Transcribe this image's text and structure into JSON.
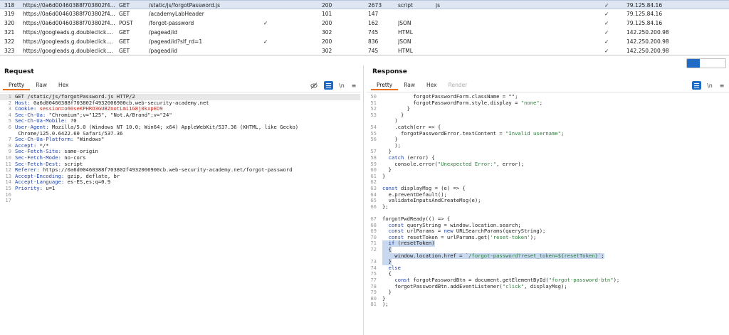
{
  "history": {
    "rows": [
      {
        "num": "318",
        "host": "https://0a6d00460388f703802f4...",
        "method": "GET",
        "url": "/static/js/forgotPassword.js",
        "params": "",
        "status": "200",
        "length": "2673",
        "mime": "script",
        "ext": "js",
        "checked": "✓",
        "ip": "79.125.84.16",
        "selected": true
      },
      {
        "num": "319",
        "host": "https://0a6d00460388f703802f4...",
        "method": "GET",
        "url": "/academyLabHeader",
        "params": "",
        "status": "101",
        "length": "147",
        "mime": "",
        "ext": "",
        "checked": "✓",
        "ip": "79.125.84.16"
      },
      {
        "num": "320",
        "host": "https://0a6d00460388f703802f4...",
        "method": "POST",
        "url": "/forgot-password",
        "params": "✓",
        "status": "200",
        "length": "162",
        "mime": "JSON",
        "ext": "",
        "checked": "✓",
        "ip": "79.125.84.16"
      },
      {
        "num": "321",
        "host": "https://googleads.g.doubleclick....",
        "method": "GET",
        "url": "/pagead/id",
        "params": "",
        "status": "302",
        "length": "745",
        "mime": "HTML",
        "ext": "",
        "checked": "✓",
        "ip": "142.250.200.98"
      },
      {
        "num": "322",
        "host": "https://googleads.g.doubleclick....",
        "method": "GET",
        "url": "/pagead/id?slf_rd=1",
        "params": "✓",
        "status": "200",
        "length": "836",
        "mime": "JSON",
        "ext": "",
        "checked": "✓",
        "ip": "142.250.200.98"
      },
      {
        "num": "323",
        "host": "https://googleads.g.doubleclick....",
        "method": "GET",
        "url": "/pagead/id",
        "params": "",
        "status": "302",
        "length": "745",
        "mime": "HTML",
        "ext": "",
        "checked": "✓",
        "ip": "142.250.200.98"
      }
    ]
  },
  "request": {
    "title": "Request",
    "tabs": [
      "Pretty",
      "Raw",
      "Hex"
    ],
    "active_tab": "Pretty",
    "tool_ln": "\\n",
    "lines": [
      {
        "n": "1",
        "parts": [
          [
            "v",
            "GET /static/js/forgotPassword.js HTTP/2"
          ]
        ],
        "current": true
      },
      {
        "n": "2",
        "parts": [
          [
            "k",
            "Host: "
          ],
          [
            "v",
            "0a6d00460388f703802f4932006900cb.web-security-academy.net"
          ]
        ]
      },
      {
        "n": "3",
        "parts": [
          [
            "k",
            "Cookie: "
          ],
          [
            "red",
            "session=o60seKPHRO3GUBZnotLmi1G8j0kxpED9"
          ]
        ]
      },
      {
        "n": "4",
        "parts": [
          [
            "k",
            "Sec-Ch-Ua: "
          ],
          [
            "v",
            "\"Chromium\";v=\"125\", \"Not.A/Brand\";v=\"24\""
          ]
        ]
      },
      {
        "n": "5",
        "parts": [
          [
            "k",
            "Sec-Ch-Ua-Mobile: "
          ],
          [
            "v",
            "?0"
          ]
        ]
      },
      {
        "n": "6",
        "parts": [
          [
            "k",
            "User-Agent: "
          ],
          [
            "v",
            "Mozilla/5.0 (Windows NT 10.0; Win64; x64) AppleWebKit/537.36 (KHTML, like Gecko)"
          ]
        ]
      },
      {
        "n": "",
        "parts": [
          [
            "v",
            " Chrome/125.0.6422.60 Safari/537.36"
          ]
        ]
      },
      {
        "n": "7",
        "parts": [
          [
            "k",
            "Sec-Ch-Ua-Platform: "
          ],
          [
            "v",
            "\"Windows\""
          ]
        ]
      },
      {
        "n": "8",
        "parts": [
          [
            "k",
            "Accept: "
          ],
          [
            "v",
            "*/*"
          ]
        ]
      },
      {
        "n": "9",
        "parts": [
          [
            "k",
            "Sec-Fetch-Site: "
          ],
          [
            "v",
            "same-origin"
          ]
        ]
      },
      {
        "n": "10",
        "parts": [
          [
            "k",
            "Sec-Fetch-Mode: "
          ],
          [
            "v",
            "no-cors"
          ]
        ]
      },
      {
        "n": "11",
        "parts": [
          [
            "k",
            "Sec-Fetch-Dest: "
          ],
          [
            "v",
            "script"
          ]
        ]
      },
      {
        "n": "12",
        "parts": [
          [
            "k",
            "Referer: "
          ],
          [
            "v",
            "https://0a6d00460388f703802f4932006900cb.web-security-academy.net/forgot-password"
          ]
        ]
      },
      {
        "n": "13",
        "parts": [
          [
            "k",
            "Accept-Encoding: "
          ],
          [
            "v",
            "gzip, deflate, br"
          ]
        ]
      },
      {
        "n": "14",
        "parts": [
          [
            "k",
            "Accept-Language: "
          ],
          [
            "v",
            "es-ES,es;q=0.9"
          ]
        ]
      },
      {
        "n": "15",
        "parts": [
          [
            "k",
            "Priority: "
          ],
          [
            "v",
            "u=1"
          ]
        ]
      },
      {
        "n": "16",
        "parts": []
      },
      {
        "n": "17",
        "parts": []
      }
    ]
  },
  "response": {
    "title": "Response",
    "tabs": [
      "Pretty",
      "Raw",
      "Hex",
      "Render"
    ],
    "active_tab": "Pretty",
    "tool_ln": "\\n",
    "lines": [
      {
        "n": "50",
        "parts": [
          [
            "v",
            "          forgotPasswordForm.className = \"\";"
          ]
        ]
      },
      {
        "n": "51",
        "parts": [
          [
            "v",
            "          forgotPasswordForm.style.display = "
          ],
          [
            "str",
            "\"none\""
          ],
          [
            "v",
            ";"
          ]
        ]
      },
      {
        "n": "52",
        "parts": [
          [
            "v",
            "        }"
          ]
        ]
      },
      {
        "n": "53",
        "parts": [
          [
            "v",
            "      }"
          ]
        ]
      },
      {
        "n": "",
        "parts": [
          [
            "v",
            "    )"
          ]
        ]
      },
      {
        "n": "54",
        "parts": [
          [
            "v",
            "    .catch(err => {"
          ]
        ]
      },
      {
        "n": "55",
        "parts": [
          [
            "v",
            "      forgotPasswordError.textContent = "
          ],
          [
            "str",
            "\"Invalid username\""
          ],
          [
            "v",
            ";"
          ]
        ]
      },
      {
        "n": "56",
        "parts": [
          [
            "v",
            "    }"
          ]
        ]
      },
      {
        "n": "",
        "parts": [
          [
            "v",
            "    );"
          ]
        ]
      },
      {
        "n": "57",
        "parts": [
          [
            "v",
            "  }"
          ]
        ]
      },
      {
        "n": "58",
        "parts": [
          [
            "v",
            "  "
          ],
          [
            "kw",
            "catch"
          ],
          [
            "v",
            " (error) {"
          ]
        ]
      },
      {
        "n": "59",
        "parts": [
          [
            "v",
            "    console.error("
          ],
          [
            "str",
            "\"Unexpected Error:\""
          ],
          [
            "v",
            ", error);"
          ]
        ]
      },
      {
        "n": "60",
        "parts": [
          [
            "v",
            "  }"
          ]
        ]
      },
      {
        "n": "61",
        "parts": [
          [
            "v",
            "}"
          ]
        ]
      },
      {
        "n": "62",
        "parts": []
      },
      {
        "n": "63",
        "parts": [
          [
            "kw",
            "const"
          ],
          [
            "v",
            " displayMsg = (e) => {"
          ]
        ]
      },
      {
        "n": "64",
        "parts": [
          [
            "v",
            "  e.preventDefault();"
          ]
        ]
      },
      {
        "n": "65",
        "parts": [
          [
            "v",
            "  validateInputsAndCreateMsg(e);"
          ]
        ]
      },
      {
        "n": "66",
        "parts": [
          [
            "v",
            "};"
          ]
        ]
      },
      {
        "n": "",
        "parts": []
      },
      {
        "n": "67",
        "parts": [
          [
            "v",
            "forgotPwdReady(() => {"
          ]
        ]
      },
      {
        "n": "68",
        "parts": [
          [
            "v",
            "  "
          ],
          [
            "kw",
            "const"
          ],
          [
            "v",
            " queryString = window.location.search;"
          ]
        ]
      },
      {
        "n": "69",
        "parts": [
          [
            "v",
            "  "
          ],
          [
            "kw",
            "const"
          ],
          [
            "v",
            " urlParams = "
          ],
          [
            "kw",
            "new"
          ],
          [
            "v",
            " URLSearchParams(queryString);"
          ]
        ]
      },
      {
        "n": "70",
        "parts": [
          [
            "v",
            "  "
          ],
          [
            "kw",
            "const"
          ],
          [
            "v",
            " resetToken = urlParams.get("
          ],
          [
            "str",
            "'reset-token'"
          ],
          [
            "v",
            ");"
          ]
        ]
      },
      {
        "n": "71",
        "parts": [
          [
            "kw",
            "  if"
          ],
          [
            "v",
            " (resetToken)"
          ]
        ],
        "highlight": true
      },
      {
        "n": "72",
        "parts": [
          [
            "v",
            "  {"
          ]
        ],
        "highlight": true
      },
      {
        "n": "",
        "parts": [
          [
            "v",
            "    window.location.href = "
          ],
          [
            "str",
            "`/forgot-password?reset_token=${resetToken}`"
          ],
          [
            "v",
            ";"
          ]
        ],
        "highlight": true
      },
      {
        "n": "73",
        "parts": [
          [
            "v",
            "  }"
          ]
        ],
        "highlight": true
      },
      {
        "n": "74",
        "parts": [
          [
            "kw",
            "  else"
          ]
        ]
      },
      {
        "n": "75",
        "parts": [
          [
            "v",
            "  {"
          ]
        ]
      },
      {
        "n": "77",
        "parts": [
          [
            "v",
            "    "
          ],
          [
            "kw",
            "const"
          ],
          [
            "v",
            " forgotPasswordBtn = document.getElementById("
          ],
          [
            "str",
            "\"forgot-password-btn\""
          ],
          [
            "v",
            ");"
          ]
        ]
      },
      {
        "n": "78",
        "parts": [
          [
            "v",
            "    forgotPasswordBtn.addEventListener("
          ],
          [
            "str",
            "\"click\""
          ],
          [
            "v",
            ", displayMsg);"
          ]
        ]
      },
      {
        "n": "79",
        "parts": [
          [
            "v",
            "  }"
          ]
        ]
      },
      {
        "n": "80",
        "parts": [
          [
            "v",
            "}"
          ]
        ]
      },
      {
        "n": "81",
        "parts": [
          [
            "v",
            ");"
          ]
        ]
      }
    ]
  }
}
